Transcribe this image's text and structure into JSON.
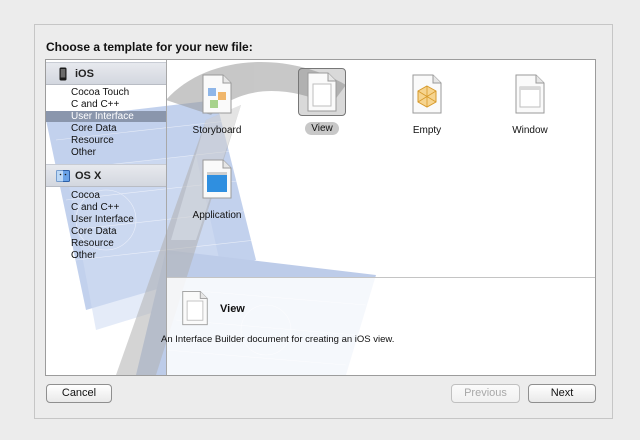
{
  "header": {
    "title": "Choose a template for your new file:"
  },
  "sidebar": {
    "sections": [
      {
        "title": "iOS",
        "icon": "iphone-icon",
        "items": [
          "Cocoa Touch",
          "C and C++",
          "User Interface",
          "Core Data",
          "Resource",
          "Other"
        ]
      },
      {
        "title": "OS X",
        "icon": "finder-icon",
        "items": [
          "Cocoa",
          "C and C++",
          "User Interface",
          "Core Data",
          "Resource",
          "Other"
        ]
      }
    ],
    "selected": "User Interface"
  },
  "templates": {
    "items": [
      {
        "label": "Storyboard",
        "icon": "storyboard-file-icon"
      },
      {
        "label": "View",
        "icon": "view-file-icon",
        "selected": true
      },
      {
        "label": "Empty",
        "icon": "empty-file-icon"
      },
      {
        "label": "Window",
        "icon": "window-file-icon"
      },
      {
        "label": "Application",
        "icon": "application-file-icon"
      }
    ]
  },
  "description": {
    "title": "View",
    "text": "An Interface Builder document for creating an iOS view."
  },
  "buttons": {
    "cancel": "Cancel",
    "previous": "Previous",
    "next": "Next"
  },
  "colors": {
    "selection": "#8a96ac",
    "blueprint": "#5b7fc9"
  }
}
